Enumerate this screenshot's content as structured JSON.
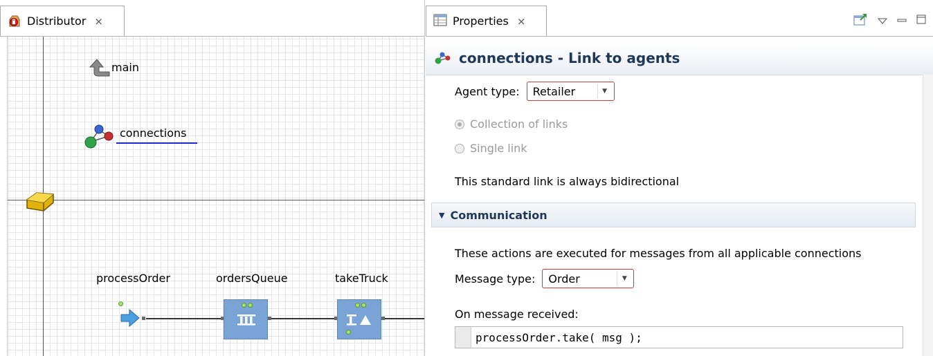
{
  "editor": {
    "tab_label": "Distributor",
    "canvas": {
      "main_label": "main",
      "connections_label": "connections",
      "blocks": [
        {
          "label": "processOrder",
          "kind": "enter"
        },
        {
          "label": "ordersQueue",
          "kind": "queue"
        },
        {
          "label": "takeTruck",
          "kind": "seize"
        }
      ]
    }
  },
  "properties": {
    "tab_label": "Properties",
    "title": "connections - Link to agents",
    "agent_type_label": "Agent type:",
    "agent_type_value": "Retailer",
    "link_options": [
      {
        "label": "Collection of links",
        "selected": true
      },
      {
        "label": "Single link",
        "selected": false
      }
    ],
    "bidirectional_note": "This standard link is always bidirectional",
    "section": {
      "title": "Communication",
      "expanded": true,
      "description": "These actions are executed for messages from all applicable connections",
      "message_type_label": "Message type:",
      "message_type_value": "Order",
      "on_message_label": "On message received:",
      "on_message_code": "processOrder.take( msg );"
    }
  },
  "colors": {
    "title_text": "#1f3857",
    "combo_border": "#c93a3a",
    "block_fill": "#7aa3d6",
    "connection_underline": "#1a2ad0"
  }
}
